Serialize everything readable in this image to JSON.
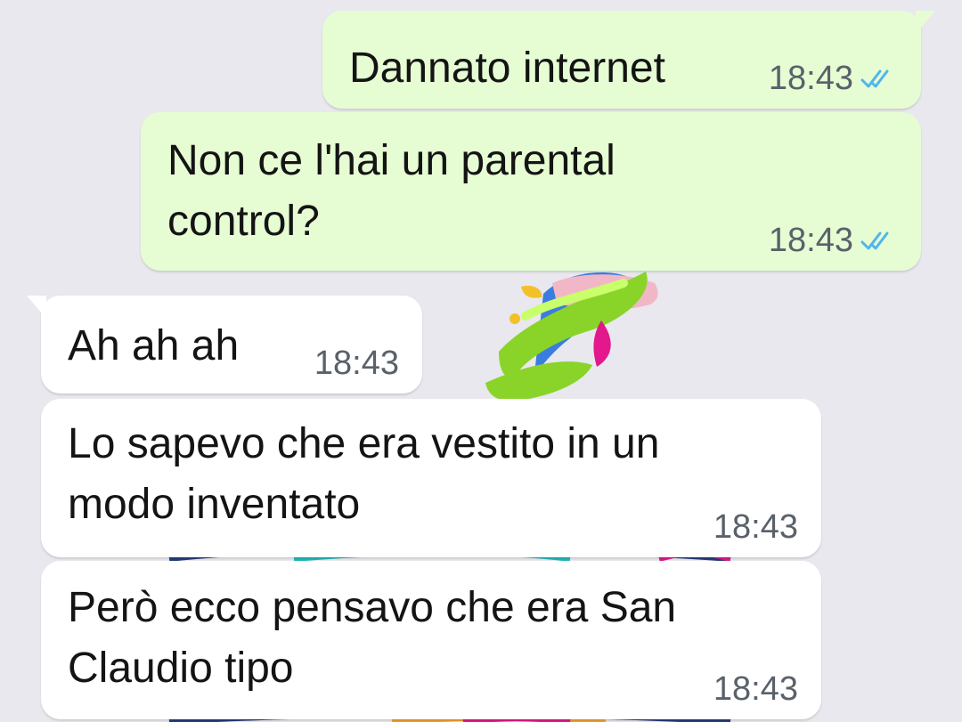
{
  "messages": [
    {
      "direction": "outgoing",
      "text": "Dannato internet",
      "time": "18:43",
      "status": "read"
    },
    {
      "direction": "outgoing",
      "line1": "Non ce l'hai un parental",
      "line2": "control?",
      "time": "18:43",
      "status": "read"
    },
    {
      "direction": "incoming",
      "text": "Ah ah ah",
      "time": "18:43"
    },
    {
      "direction": "incoming",
      "line1": "Lo sapevo che era vestito in un",
      "line2": "modo inventato",
      "time": "18:43"
    },
    {
      "direction": "incoming",
      "line1": "Però ecco pensavo che era San",
      "line2": "Claudio tipo",
      "time": "18:43"
    }
  ],
  "colors": {
    "background": "#e8e8ee",
    "outgoing_bubble": "#e6fdd4",
    "incoming_bubble": "#ffffff",
    "read_ticks": "#4fb6ec",
    "time_text": "#59616a"
  },
  "icons": {
    "read_status": "double-check-icon"
  }
}
